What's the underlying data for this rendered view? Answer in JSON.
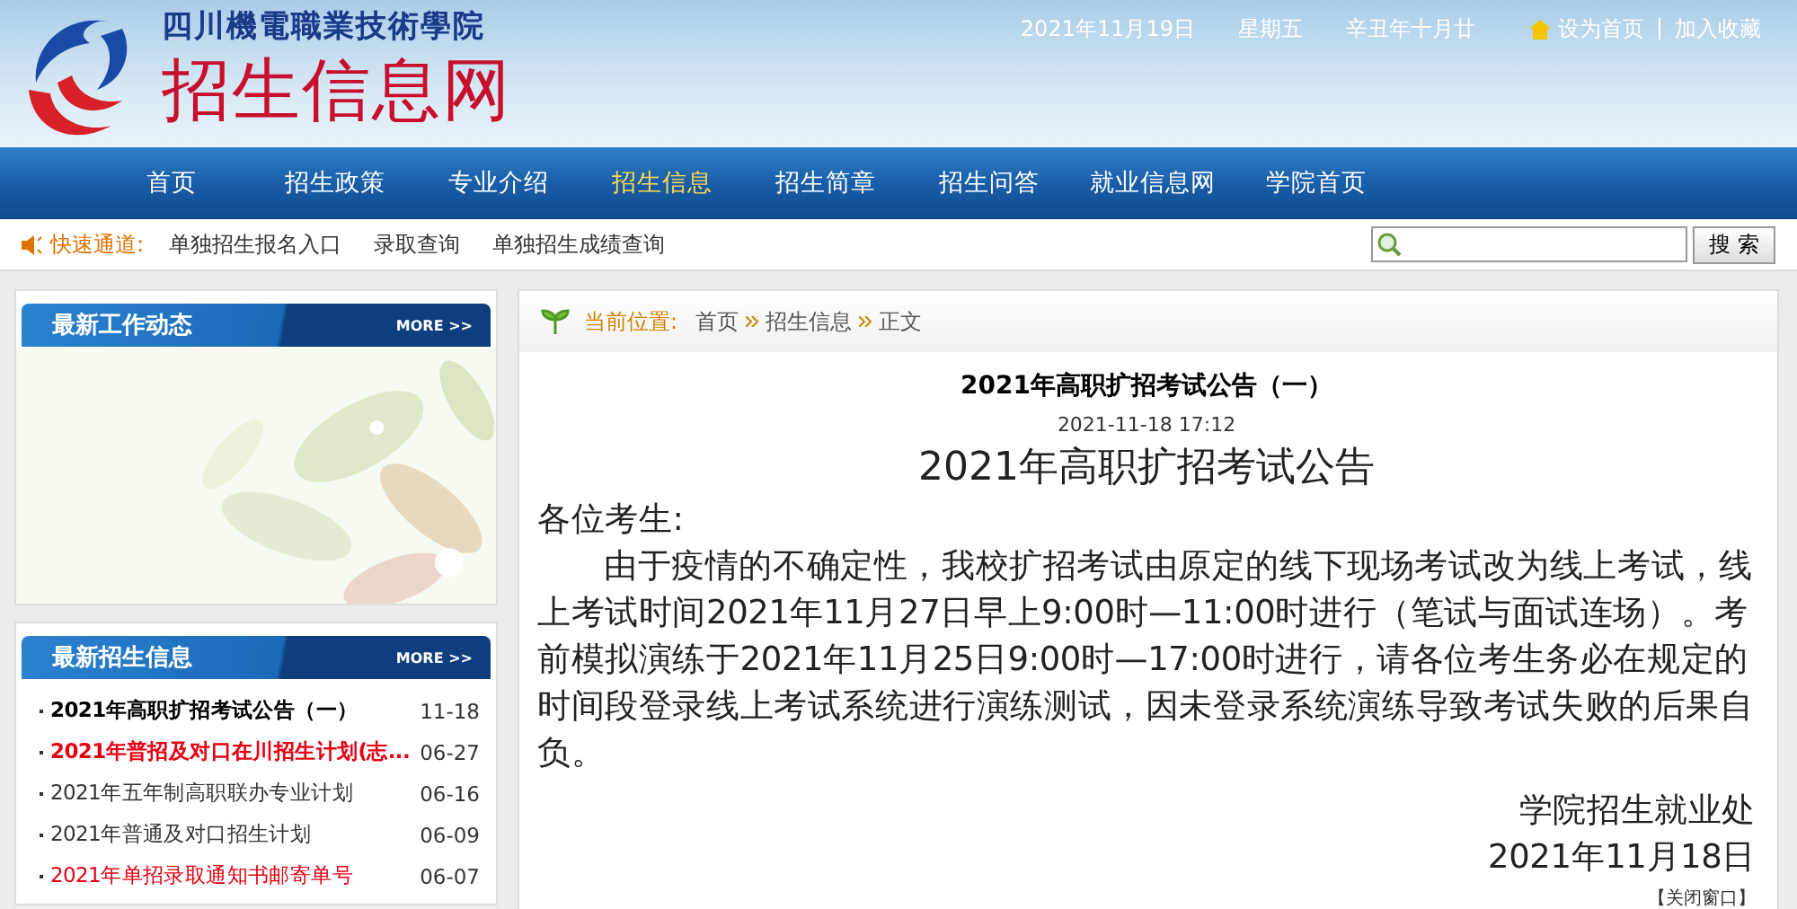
{
  "header": {
    "school_name": "四川機電職業技術學院",
    "site_title": "招生信息网",
    "date": "2021年11月19日",
    "weekday": "星期五",
    "lunar_date": "辛丑年十月廿",
    "links": [
      "设为首页",
      "加入收藏"
    ]
  },
  "nav": [
    {
      "label": "首页",
      "selected": false
    },
    {
      "label": "招生政策",
      "selected": false
    },
    {
      "label": "专业介绍",
      "selected": false
    },
    {
      "label": "招生信息",
      "selected": true
    },
    {
      "label": "招生简章",
      "selected": false
    },
    {
      "label": "招生问答",
      "selected": false
    },
    {
      "label": "就业信息网",
      "selected": false
    },
    {
      "label": "学院首页",
      "selected": false
    }
  ],
  "quick_links": {
    "label": "快速通道:",
    "links": [
      "单独招生报名入口",
      "录取查询",
      "单独招生成绩查询"
    ]
  },
  "search": {
    "button": "搜 索"
  },
  "sidebar": [
    {
      "title": "最新工作动态",
      "more": "MORE >>",
      "kind": "picture"
    },
    {
      "title": "最新招生信息",
      "more": "MORE >>",
      "kind": "list",
      "items": [
        {
          "title": "2021年高职扩招考试公告（一）",
          "date": "11-18",
          "color": "#000000",
          "bold": true
        },
        {
          "title": "2021年普招及对口在川招生计划(志...",
          "date": "06-27",
          "color": "#e60012",
          "bold": true
        },
        {
          "title": "2021年五年制高职联办专业计划",
          "date": "06-16",
          "color": "#333333",
          "bold": false
        },
        {
          "title": "2021年普通及对口招生计划",
          "date": "06-09",
          "color": "#333333",
          "bold": false
        },
        {
          "title": "2021年单招录取通知书邮寄单号",
          "date": "06-07",
          "color": "#e60012",
          "bold": false
        }
      ]
    }
  ],
  "breadcrumb": {
    "label": "当前位置:",
    "items": [
      "首页",
      "招生信息",
      "正文"
    ]
  },
  "article": {
    "title": "2021年高职扩招考试公告（一）",
    "datetime": "2021-11-18 17:12",
    "heading": "2021年高职扩招考试公告",
    "greeting": "各位考生:",
    "paragraphs": [
      "由于疫情的不确定性，我校扩招考试由原定的线下现场考试改为线上考试，线上考试时间2021年11月27日早上9:00时—11:00时进行（笔试与面试连场）。考前模拟演练于2021年11月25日9:00时—17:00时进行，请各位考生务必在规定的时间段登录线上考试系统进行演练测试，因未登录系统演练导致考试失败的后果自负。"
    ],
    "signature": "学院招生就业处",
    "sign_date": "2021年11月18日",
    "close": "【关闭窗口】"
  }
}
